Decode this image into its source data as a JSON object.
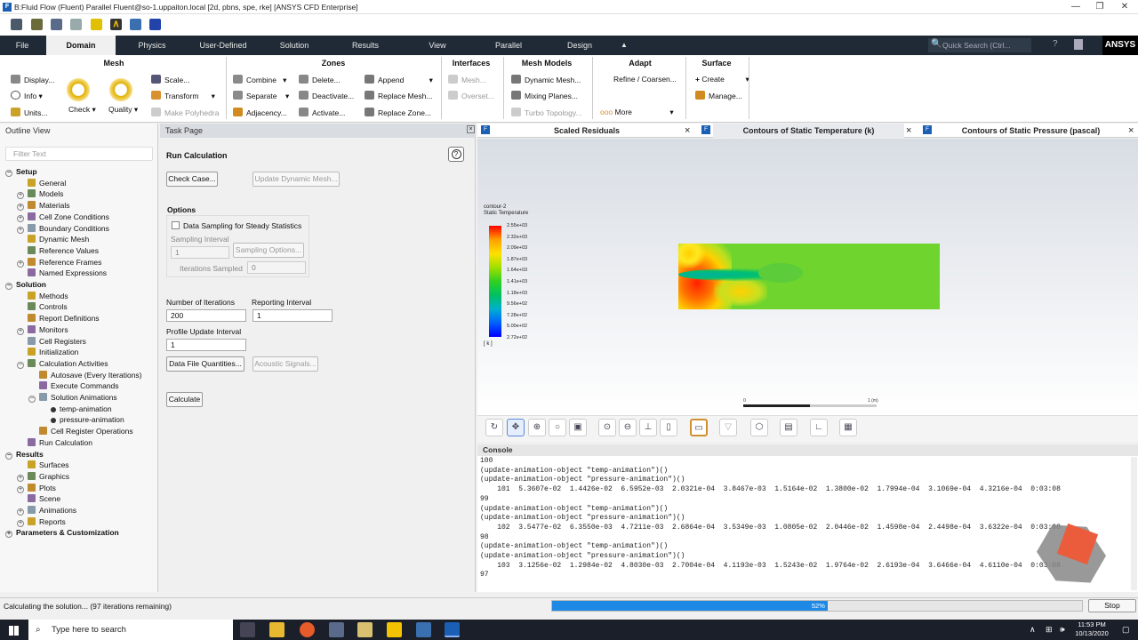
{
  "window": {
    "title": "B:Fluid Flow (Fluent) Parallel Fluent@so-1.uppaiton.local  [2d, pbns, spe, rke] [ANSYS CFD Enterprise]",
    "app_icon": "F"
  },
  "menubar": {
    "items": [
      "File",
      "Domain",
      "Physics",
      "User-Defined",
      "Solution",
      "Results",
      "View",
      "Parallel",
      "Design"
    ],
    "active": "Domain",
    "search_placeholder": "Quick Search (Ctrl...",
    "brand": "ANSYS"
  },
  "ribbon": {
    "groups": {
      "mesh": "Mesh",
      "zones": "Zones",
      "interfaces": "Interfaces",
      "mesh_models": "Mesh Models",
      "adapt": "Adapt",
      "surface": "Surface"
    },
    "mesh": {
      "display": "Display...",
      "info": "Info",
      "units": "Units...",
      "check": "Check",
      "quality": "Quality",
      "scale": "Scale...",
      "transform": "Transform",
      "make_polyhedra": "Make Polyhedra"
    },
    "zones": {
      "combine": "Combine",
      "separate": "Separate",
      "adjacency": "Adjacency...",
      "delete": "Delete...",
      "deactivate": "Deactivate...",
      "activate": "Activate...",
      "append": "Append",
      "replace_mesh": "Replace Mesh...",
      "replace_zone": "Replace Zone..."
    },
    "interfaces": {
      "mesh": "Mesh...",
      "overset": "Overset..."
    },
    "mesh_models": {
      "dynamic_mesh": "Dynamic Mesh...",
      "mixing_planes": "Mixing Planes...",
      "turbo_topology": "Turbo Topology..."
    },
    "adapt": {
      "refine": "Refine / Coarsen...",
      "more": "More"
    },
    "surface": {
      "create": "Create",
      "manage": "Manage..."
    }
  },
  "outline": {
    "header": "Outline View",
    "filter_placeholder": "Filter Text",
    "items": [
      {
        "label": "Setup",
        "bold": true,
        "exp": "−",
        "indent": 0
      },
      {
        "label": "General",
        "indent": 1
      },
      {
        "label": "Models",
        "exp": "+",
        "indent": 1
      },
      {
        "label": "Materials",
        "exp": "+",
        "indent": 1
      },
      {
        "label": "Cell Zone Conditions",
        "exp": "+",
        "indent": 1
      },
      {
        "label": "Boundary Conditions",
        "exp": "+",
        "indent": 1
      },
      {
        "label": "Dynamic Mesh",
        "indent": 1
      },
      {
        "label": "Reference Values",
        "indent": 1
      },
      {
        "label": "Reference Frames",
        "exp": "+",
        "indent": 1
      },
      {
        "label": "Named Expressions",
        "indent": 1
      },
      {
        "label": "Solution",
        "bold": true,
        "exp": "−",
        "indent": 0
      },
      {
        "label": "Methods",
        "indent": 1
      },
      {
        "label": "Controls",
        "indent": 1
      },
      {
        "label": "Report Definitions",
        "indent": 1
      },
      {
        "label": "Monitors",
        "exp": "+",
        "indent": 1
      },
      {
        "label": "Cell Registers",
        "indent": 1
      },
      {
        "label": "Initialization",
        "indent": 1
      },
      {
        "label": "Calculation Activities",
        "exp": "−",
        "indent": 1
      },
      {
        "label": "Autosave (Every Iterations)",
        "indent": 2
      },
      {
        "label": "Execute Commands",
        "indent": 2
      },
      {
        "label": "Solution Animations",
        "exp": "−",
        "indent": 2
      },
      {
        "label": "temp-animation",
        "indent": 3
      },
      {
        "label": "pressure-animation",
        "indent": 3
      },
      {
        "label": "Cell Register Operations",
        "indent": 2
      },
      {
        "label": "Run Calculation",
        "indent": 1
      },
      {
        "label": "Results",
        "bold": true,
        "exp": "−",
        "indent": 0
      },
      {
        "label": "Surfaces",
        "indent": 1
      },
      {
        "label": "Graphics",
        "exp": "+",
        "indent": 1
      },
      {
        "label": "Plots",
        "exp": "+",
        "indent": 1
      },
      {
        "label": "Scene",
        "indent": 1
      },
      {
        "label": "Animations",
        "exp": "+",
        "indent": 1
      },
      {
        "label": "Reports",
        "exp": "+",
        "indent": 1
      },
      {
        "label": "Parameters & Customization",
        "bold": true,
        "exp": "+",
        "indent": 0
      }
    ]
  },
  "task": {
    "header": "Task Page",
    "title": "Run Calculation",
    "check_case": "Check Case...",
    "update_dynamic_mesh": "Update Dynamic Mesh...",
    "options": "Options",
    "data_sampling": "Data Sampling for Steady Statistics",
    "sampling_interval": "Sampling Interval",
    "sampling_interval_value": "1",
    "sampling_options": "Sampling Options...",
    "iterations_sampled": "Iterations Sampled",
    "iterations_sampled_value": "0",
    "num_iterations_label": "Number of Iterations",
    "num_iterations": "200",
    "reporting_interval_label": "Reporting Interval",
    "reporting_interval": "1",
    "profile_update_label": "Profile Update Interval",
    "profile_update": "1",
    "data_file_quantities": "Data File Quantities...",
    "acoustic_signals": "Acoustic Signals...",
    "calculate": "Calculate"
  },
  "tabs": [
    {
      "label": "Scaled Residuals"
    },
    {
      "label": "Contours of Static Temperature (k)",
      "selected": true
    },
    {
      "label": "Contours of Static Pressure (pascal)"
    }
  ],
  "contour": {
    "name": "contour-2",
    "variable": "Static Temperature",
    "unit": "[ k ]",
    "levels": [
      "2.55e+03",
      "2.32e+03",
      "2.09e+03",
      "1.87e+03",
      "1.64e+03",
      "1.41e+03",
      "1.18e+03",
      "9.56e+02",
      "7.28e+02",
      "5.00e+02",
      "2.72e+02"
    ],
    "scale_start": "0",
    "scale_end": "1 (m)",
    "colors": {
      "hot": "#ff2000",
      "warm": "#ffd000",
      "mid": "#6fd42e",
      "cool": "#00c070"
    }
  },
  "console": {
    "header": "Console",
    "lines": [
      "100",
      "(update-animation-object \"temp-animation\")()",
      "(update-animation-object \"pressure-animation\")()",
      "    101  5.3607e-02  1.4426e-02  6.5952e-03  2.0321e-04  3.8467e-03  1.5164e-02  1.3800e-02  1.7994e-04  3.1069e-04  4.3216e-04  0:03:08",
      "99",
      "(update-animation-object \"temp-animation\")()",
      "(update-animation-object \"pressure-animation\")()",
      "    102  3.5477e-02  6.3550e-03  4.7211e-03  2.6864e-04  3.5349e-03  1.0805e-02  2.0446e-02  1.4598e-04  2.4498e-04  3.6322e-04  0:03:08",
      "98",
      "(update-animation-object \"temp-animation\")()",
      "(update-animation-object \"pressure-animation\")()",
      "    103  3.1256e-02  1.2984e-02  4.8030e-03  2.7004e-04  4.1193e-03  1.5243e-02  1.9764e-02  2.6193e-04  3.6466e-04  4.6110e-04  0:03:08",
      "97"
    ]
  },
  "status": {
    "text": "Calculating the solution... (97 iterations remaining)",
    "progress_percent": 52,
    "progress_label": "52%",
    "stop": "Stop"
  },
  "taskbar": {
    "search_placeholder": "Type here to search",
    "time": "11:53 PM",
    "date": "10/13/2020"
  }
}
